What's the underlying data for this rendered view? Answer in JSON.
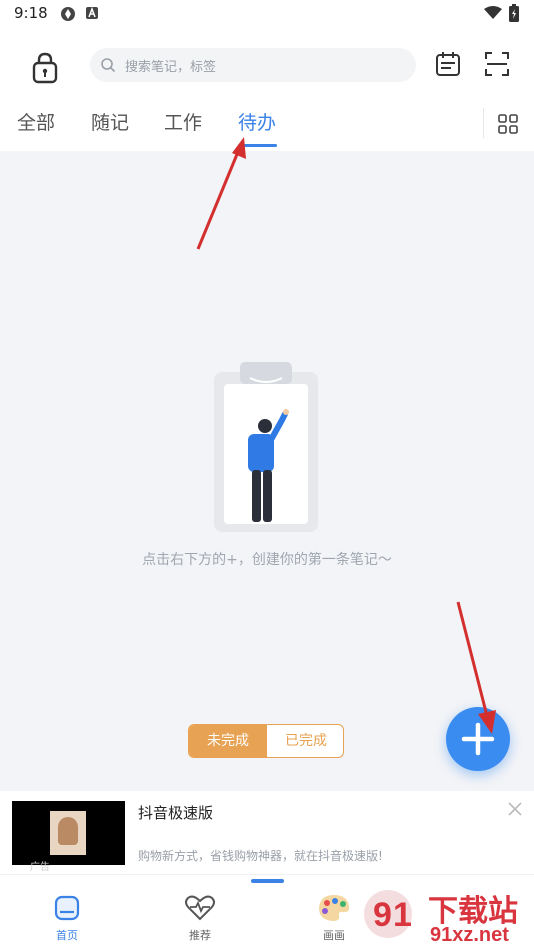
{
  "status_bar": {
    "time": "9:18"
  },
  "search": {
    "placeholder": "搜索笔记，标签"
  },
  "tabs": [
    {
      "label": "全部"
    },
    {
      "label": "随记"
    },
    {
      "label": "工作"
    },
    {
      "label": "待办",
      "active": true
    }
  ],
  "empty_state": {
    "message": "点击右下方的+，创建你的第一条笔记～"
  },
  "filter": {
    "incomplete_label": "未完成",
    "complete_label": "已完成",
    "selected": "未完成"
  },
  "ad": {
    "title": "抖音极速版",
    "description": "购物新方式，省钱购物神器，就在抖音极速版!",
    "label": "广告"
  },
  "bottom_nav": [
    {
      "label": "首页",
      "icon": "home-icon",
      "active": true
    },
    {
      "label": "推荐",
      "icon": "heart-pulse-icon"
    },
    {
      "label": "画画",
      "icon": "palette-icon"
    }
  ],
  "watermark": {
    "text": "下载站",
    "domain": "91xz.net"
  },
  "colors": {
    "accent": "#3b82e6",
    "fab": "#3a8cf0",
    "filter": "#e8a253",
    "annotation_arrow": "#d32f2f"
  }
}
